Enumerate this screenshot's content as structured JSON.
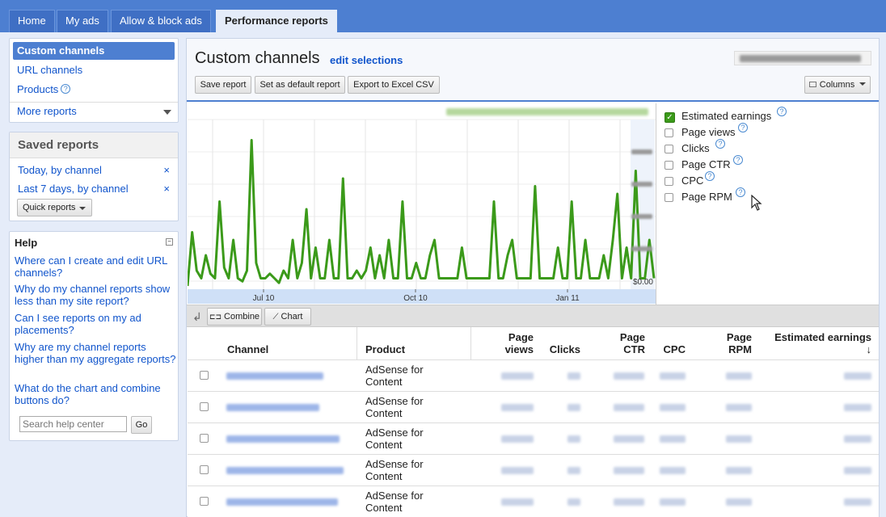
{
  "nav": {
    "tabs": [
      {
        "label": "Home"
      },
      {
        "label": "My ads"
      },
      {
        "label": "Allow & block ads"
      },
      {
        "label": "Performance reports"
      }
    ]
  },
  "sidebar": {
    "items": [
      {
        "label": "Custom channels"
      },
      {
        "label": "URL channels"
      },
      {
        "label": "Products"
      },
      {
        "label": "More reports"
      }
    ]
  },
  "saved": {
    "title": "Saved reports",
    "items": [
      {
        "label": "Today, by channel",
        "remove": "×"
      },
      {
        "label": "Last 7 days, by channel",
        "remove": "×"
      }
    ],
    "quick_label": "Quick reports"
  },
  "help": {
    "title": "Help",
    "links": [
      "Where can I create and edit URL channels?",
      "Why do my channel reports show less than my site report?",
      "Can I see reports on my ad placements?",
      "Why are my channel reports higher than my aggregate reports?",
      "What do the chart and combine buttons do?"
    ],
    "search_placeholder": "Search help center",
    "go_label": "Go"
  },
  "report": {
    "title": "Custom channels",
    "edit_label": "edit selections",
    "save_label": "Save report",
    "default_label": "Set as default report",
    "export_label": "Export to Excel CSV",
    "columns_label": "Columns",
    "combine_label": "Combine",
    "chart_label": "Chart"
  },
  "metrics": [
    {
      "label": "Estimated earnings",
      "checked": true
    },
    {
      "label": "Page views",
      "checked": false
    },
    {
      "label": "Clicks",
      "checked": false
    },
    {
      "label": "Page CTR",
      "checked": false
    },
    {
      "label": "CPC",
      "checked": false
    },
    {
      "label": "Page RPM",
      "checked": false
    }
  ],
  "chart_data": {
    "type": "line",
    "x_ticks": [
      "Jul 10",
      "Oct 10",
      "Jan 11"
    ],
    "y_tick": "$0.00",
    "series": [
      {
        "color": "#3b9a1a",
        "values": [
          0,
          0.35,
          0.1,
          0.05,
          0.2,
          0.08,
          0.05,
          0.55,
          0.12,
          0.05,
          0.3,
          0.05,
          0.03,
          0.1,
          0.95,
          0.15,
          0.05,
          0.05,
          0.08,
          0.05,
          0.02,
          0.1,
          0.05,
          0.3,
          0.05,
          0.15,
          0.5,
          0.05,
          0.25,
          0.05,
          0.05,
          0.3,
          0.05,
          0.05,
          0.7,
          0.05,
          0.05,
          0.1,
          0.05,
          0.1,
          0.25,
          0.05,
          0.2,
          0.05,
          0.3,
          0.05,
          0.05,
          0.55,
          0.05,
          0.05,
          0.15,
          0.05,
          0.05,
          0.2,
          0.3,
          0.05,
          0.05,
          0.05,
          0.05,
          0.05,
          0.25,
          0.05,
          0.05,
          0.05,
          0.05,
          0.05,
          0.05,
          0.55,
          0.05,
          0.05,
          0.2,
          0.3,
          0.05,
          0.05,
          0.05,
          0.05,
          0.65,
          0.05,
          0.05,
          0.05,
          0.05,
          0.25,
          0.05,
          0.05,
          0.55,
          0.05,
          0.05,
          0.3,
          0.05,
          0.05,
          0.05,
          0.2,
          0.05,
          0.3,
          0.6,
          0.05,
          0.25,
          0.05,
          0.75,
          0.05,
          0.05,
          0.3,
          0.05
        ]
      }
    ]
  },
  "table": {
    "headers": [
      "Channel",
      "Product",
      "Page views",
      "Clicks",
      "Page CTR",
      "CPC",
      "Page RPM",
      "Estimated earnings"
    ],
    "rows": [
      {
        "product": "AdSense for Content"
      },
      {
        "product": "AdSense for Content"
      },
      {
        "product": "AdSense for Content"
      },
      {
        "product": "AdSense for Content"
      },
      {
        "product": "AdSense for Content"
      }
    ]
  }
}
